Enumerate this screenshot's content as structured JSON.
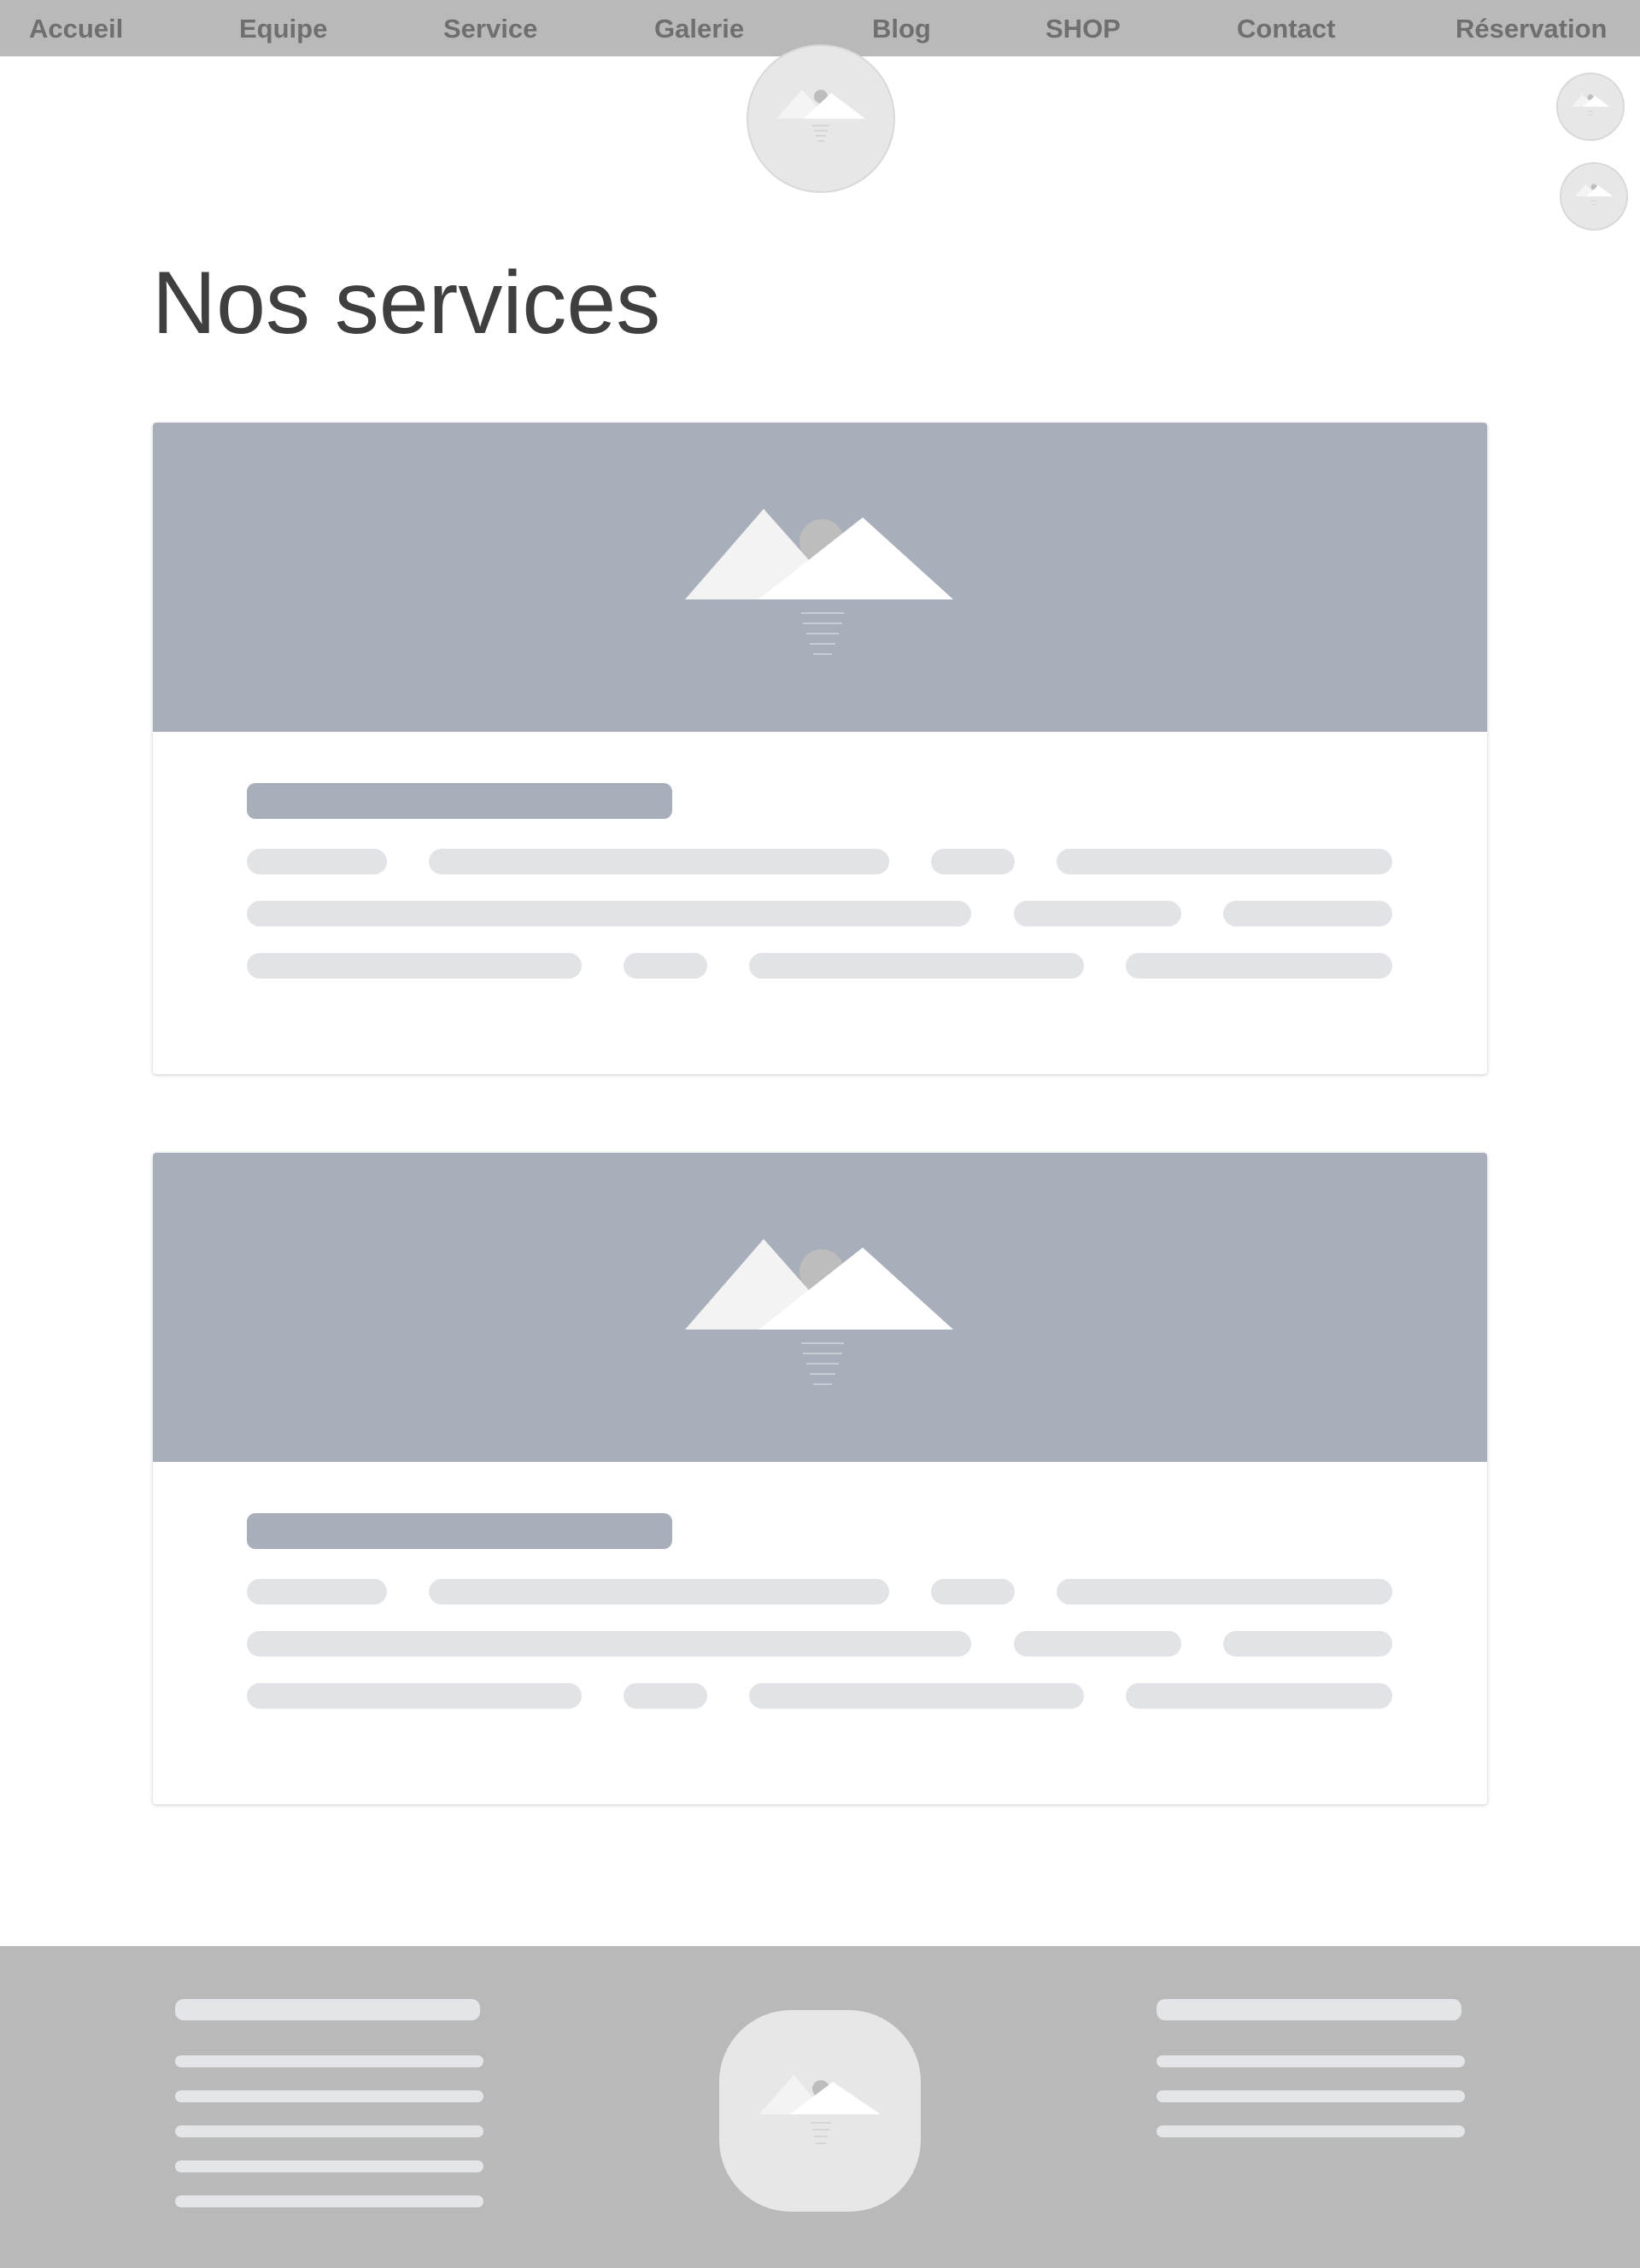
{
  "nav": {
    "items": [
      {
        "label": "Accueil"
      },
      {
        "label": "Equipe"
      },
      {
        "label": "Service"
      },
      {
        "label": "Galerie"
      },
      {
        "label": "Blog"
      },
      {
        "label": "SHOP"
      },
      {
        "label": "Contact"
      },
      {
        "label": "Réservation"
      }
    ]
  },
  "header": {
    "logo_icon": "image-placeholder-icon",
    "floating_icons": [
      "image-placeholder-icon",
      "image-placeholder-icon"
    ]
  },
  "main": {
    "title": "Nos services",
    "cards": [
      {
        "image_icon": "image-placeholder-icon"
      },
      {
        "image_icon": "image-placeholder-icon"
      }
    ]
  },
  "footer": {
    "logo_icon": "image-placeholder-icon"
  },
  "colors": {
    "nav_background": "#b9b9b9",
    "nav_text": "#6f6f6f",
    "title_text": "#3f3f3f",
    "placeholder_media": "#a9afba",
    "placeholder_line": "#e1e3e7",
    "footer_background": "#b9b9b9"
  }
}
